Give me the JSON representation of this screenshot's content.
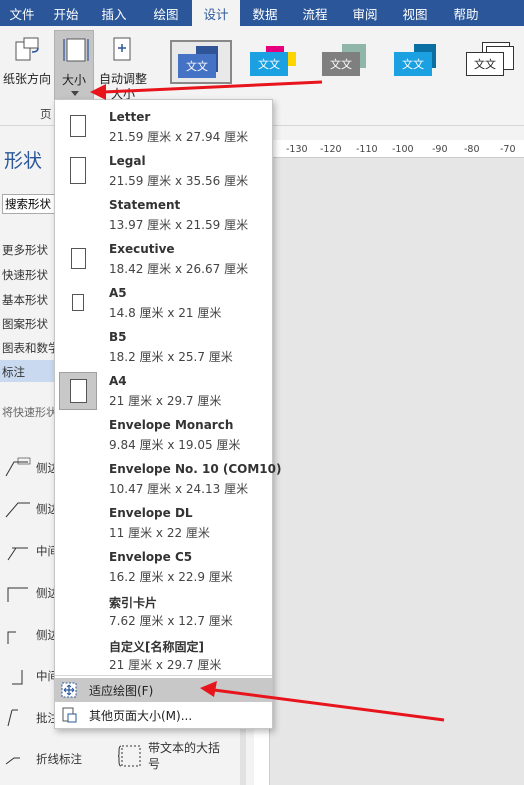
{
  "menubar": {
    "tabs": [
      {
        "label": "文件",
        "active": false
      },
      {
        "label": "开始",
        "active": false
      },
      {
        "label": "插入",
        "active": false
      },
      {
        "label": "绘图",
        "active": false
      },
      {
        "label": "设计",
        "active": true
      },
      {
        "label": "数据",
        "active": false
      },
      {
        "label": "流程",
        "active": false
      },
      {
        "label": "审阅",
        "active": false
      },
      {
        "label": "视图",
        "active": false
      },
      {
        "label": "帮助",
        "active": false
      }
    ]
  },
  "ribbon": {
    "orientation_line1": "纸张方向",
    "size_line1": "大小",
    "autofit_line1": "自动调整",
    "autofit_line2": "大小",
    "group_label": "页",
    "theme_text": "文文",
    "colors": {
      "brand": "#2b579a",
      "theme1_front": "#4472c4",
      "theme2_front": "#1ba1e2",
      "theme3_front": "#7f7f7f",
      "theme4_front": "#1ba1e2",
      "theme5_front": "#ffffff"
    }
  },
  "shapes_pane": {
    "title": "形状",
    "search_placeholder": "搜索形状",
    "categories": [
      "更多形状",
      "快速形状",
      "基本形状",
      "图案形状",
      "图表和数学",
      "标注"
    ],
    "selected_category": "标注",
    "hint": "将快速形状",
    "stencils": [
      "侧边",
      "侧边",
      "中间",
      "侧边",
      "侧边",
      "中间",
      "批注",
      "折线标注"
    ]
  },
  "ruler": {
    "ticks": [
      "-130",
      "-120",
      "-110",
      "-100",
      "-90",
      "-80",
      "-70"
    ]
  },
  "dropdown": {
    "items": [
      {
        "title": "Letter",
        "dims": "21.59 厘米 x 27.94 厘米",
        "selected": false
      },
      {
        "title": "Legal",
        "dims": "21.59 厘米 x 35.56 厘米",
        "selected": false
      },
      {
        "title": "Statement",
        "dims": "13.97 厘米 x 21.59 厘米",
        "selected": false
      },
      {
        "title": "Executive",
        "dims": "18.42 厘米 x 26.67 厘米",
        "selected": false
      },
      {
        "title": "A5",
        "dims": "14.8 厘米 x 21 厘米",
        "selected": false
      },
      {
        "title": "B5",
        "dims": "18.2 厘米 x 25.7 厘米",
        "selected": false
      },
      {
        "title": "A4",
        "dims": "21 厘米 x 29.7 厘米",
        "selected": true
      },
      {
        "title": "Envelope Monarch",
        "dims": "9.84 厘米 x 19.05 厘米",
        "selected": false
      },
      {
        "title": "Envelope No. 10 (COM10)",
        "dims": "10.47 厘米 x 24.13 厘米",
        "selected": false
      },
      {
        "title": "Envelope DL",
        "dims": "11 厘米 x 22 厘米",
        "selected": false
      },
      {
        "title": "Envelope C5",
        "dims": "16.2 厘米 x 22.9 厘米",
        "selected": false
      },
      {
        "title": "索引卡片",
        "dims": "7.62 厘米 x 12.7 厘米",
        "selected": false
      },
      {
        "title": "自定义[名称固定]",
        "dims": "21 厘米 x 29.7 厘米",
        "selected": false
      }
    ],
    "fit_drawing": "适应绘图(F)",
    "more_sizes": "其他页面大小(M)..."
  },
  "bottom_stencil": {
    "bracket_label": "带文本的大括号"
  },
  "annotation_color": "#e8141c"
}
